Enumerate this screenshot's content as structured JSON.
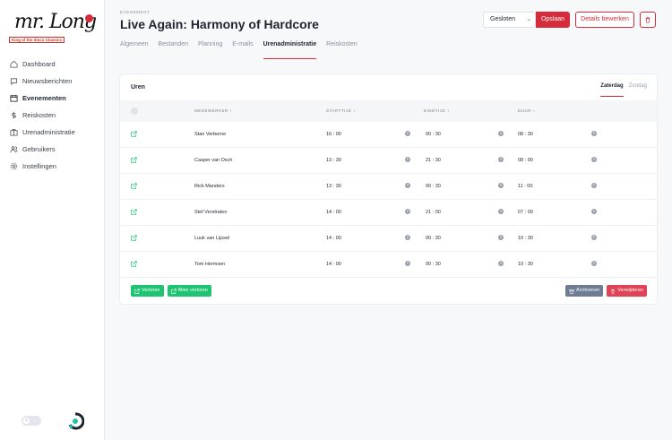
{
  "logo": {
    "script": "mr. Long",
    "tagline": "King of the disco Classics"
  },
  "nav": {
    "items": [
      {
        "label": "Dashboard",
        "icon": "home-icon"
      },
      {
        "label": "Nieuwsberichten",
        "icon": "chat-icon"
      },
      {
        "label": "Evenementen",
        "icon": "calendar-icon",
        "active": true
      },
      {
        "label": "Reiskosten",
        "icon": "dollar-icon"
      },
      {
        "label": "Urenadministratie",
        "icon": "briefcase-icon"
      },
      {
        "label": "Gebruikers",
        "icon": "users-icon"
      },
      {
        "label": "Instellingen",
        "icon": "gear-icon"
      }
    ]
  },
  "header": {
    "eyebrow": "EVENEMENT",
    "title": "Live Again: Harmony of Hardcore",
    "status_value": "Gesloten",
    "save_label": "Opslaan",
    "edit_label": "Details bewerken"
  },
  "tabs": [
    {
      "label": "Algemeen"
    },
    {
      "label": "Bestanden"
    },
    {
      "label": "Planning"
    },
    {
      "label": "E-mails"
    },
    {
      "label": "Urenadministratie",
      "active": true
    },
    {
      "label": "Reiskosten"
    }
  ],
  "card": {
    "title": "Uren",
    "day_tabs": [
      {
        "label": "Zaterdag",
        "active": true
      },
      {
        "label": "Zondag"
      }
    ],
    "columns": {
      "employee": "MEDEWERKER ↕",
      "start": "STARTTIJD ↕",
      "end": "EINDTIJD ↕",
      "duration": "DUUR ↕"
    },
    "rows": [
      {
        "employee": "Stan Verberne",
        "start": "16 : 00",
        "end": "00 : 30",
        "duration": "08 : 30"
      },
      {
        "employee": "Casper van Osch",
        "start": "13 : 30",
        "end": "21 : 30",
        "duration": "08 : 00"
      },
      {
        "employee": "Rick Manders",
        "start": "13 : 30",
        "end": "00 : 30",
        "duration": "11 : 00"
      },
      {
        "employee": "Stef Verstraten",
        "start": "14 : 00",
        "end": "21 : 00",
        "duration": "07 : 00"
      },
      {
        "employee": "Luuk van Lijssel",
        "start": "14 : 00",
        "end": "00 : 30",
        "duration": "10 : 30"
      },
      {
        "employee": "Tom Hermsen",
        "start": "14 : 00",
        "end": "00 : 30",
        "duration": "10 : 30"
      }
    ],
    "actions": {
      "open": "Verloren",
      "open_all": "Alles verloren",
      "archive": "Archiveren",
      "delete": "Verwijderen"
    }
  },
  "colors": {
    "brand": "#d62b3a",
    "green": "#1fc472",
    "archive": "#6f7d94",
    "delete": "#e04256"
  }
}
